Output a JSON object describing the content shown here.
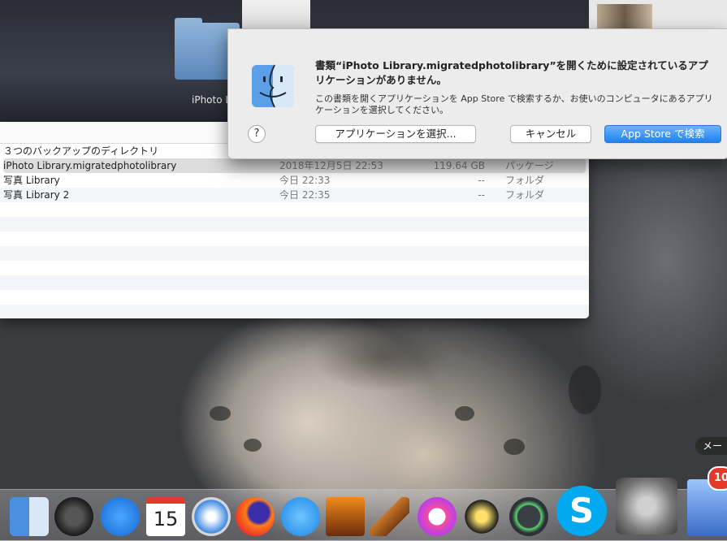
{
  "quicklook": {
    "title": "iPhoto L"
  },
  "finder": {
    "rows": [
      {
        "name": "３つのバックアップのディレクトリ",
        "date": "",
        "size": "",
        "kind": ""
      },
      {
        "name": "iPhoto Library.migratedphotolibrary",
        "date": "2018年12月5日 22:53",
        "size": "119.64 GB",
        "kind": "パッケージ"
      },
      {
        "name": "写真 Library",
        "date": "今日 22:33",
        "size": "--",
        "kind": "フォルダ"
      },
      {
        "name": "写真 Library 2",
        "date": "今日 22:35",
        "size": "--",
        "kind": "フォルダ"
      }
    ]
  },
  "dialog": {
    "title": "書類“iPhoto Library.migratedphotolibrary”を開くために設定されているアプリケーションがありません。",
    "body": "この書類を開くアプリケーションを App Store で検索するか、お使いのコンピュータにあるアプリケーションを選択してください。",
    "help_label": "?",
    "choose_button": "アプリケーションを選択...",
    "cancel_button": "キャンセル",
    "appstore_button": "App Store で検索"
  },
  "dock": {
    "items": [
      "finder-icon",
      "dashboard-icon",
      "app-store-icon",
      "calendar-icon",
      "safari-icon",
      "firefox-icon",
      "messages-icon",
      "photo-booth-icon",
      "garageband-icon",
      "itunes-icon",
      "imovie-icon",
      "time-machine-icon",
      "skype-icon",
      "system-preferences-icon",
      "mail-icon"
    ],
    "calendar_day": "15",
    "mail_badge": "10",
    "tooltip": "メー"
  },
  "colors": {
    "accent": "#1e82ef",
    "badge": "#e23b2d"
  }
}
